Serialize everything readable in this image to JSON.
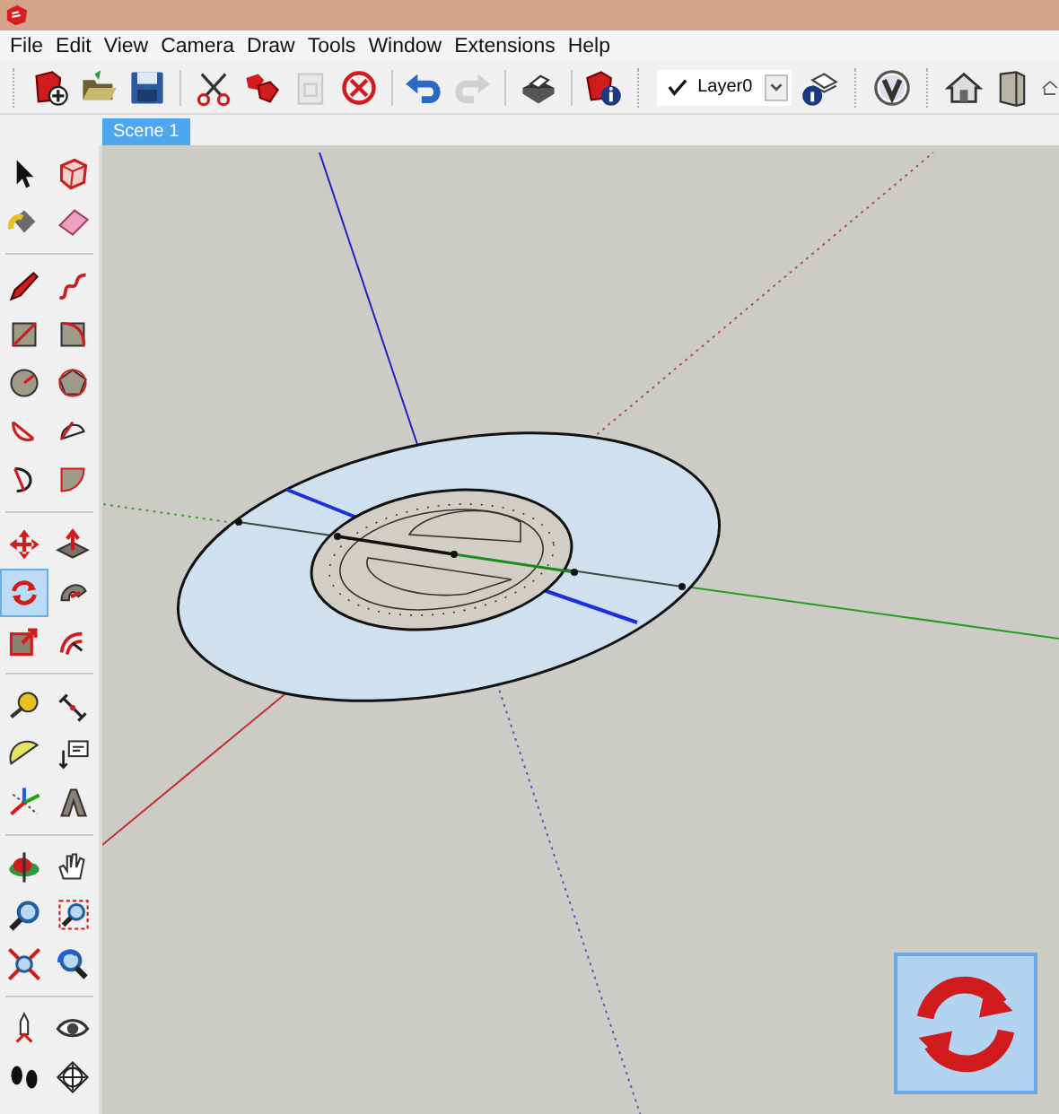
{
  "menu": [
    "File",
    "Edit",
    "View",
    "Camera",
    "Draw",
    "Tools",
    "Window",
    "Extensions",
    "Help"
  ],
  "toolbar": [
    {
      "disabled": false
    },
    {
      "disabled": false
    },
    {
      "disabled": false
    },
    {
      "disabled": false
    },
    {
      "disabled": false
    },
    {
      "disabled": true
    },
    {
      "disabled": false
    },
    {
      "disabled": false
    },
    {
      "disabled": true
    },
    {
      "disabled": false
    },
    {
      "disabled": false
    }
  ],
  "layer_select": {
    "value": "Layer0"
  },
  "scene_tabs": [
    {
      "label": "Scene 1",
      "selected": true
    }
  ],
  "tool_groups": [
    {
      "tools": [
        {
          "selected": false
        },
        {
          "selected": false
        },
        {
          "selected": false
        },
        {
          "selected": false
        }
      ]
    },
    {
      "tools": [
        {
          "selected": false
        },
        {
          "selected": false
        },
        {
          "selected": false
        },
        {
          "selected": false
        },
        {
          "selected": false
        },
        {
          "selected": false
        },
        {
          "selected": false
        },
        {
          "selected": false
        },
        {
          "selected": false
        },
        {
          "selected": false
        }
      ]
    },
    {
      "tools": [
        {
          "selected": false
        },
        {
          "selected": false
        },
        {
          "selected": true
        },
        {
          "selected": false
        },
        {
          "selected": false
        },
        {
          "selected": false
        }
      ]
    },
    {
      "tools": [
        {
          "selected": false
        },
        {
          "selected": false
        },
        {
          "selected": false
        },
        {
          "selected": false
        },
        {
          "selected": false
        },
        {
          "selected": false
        }
      ]
    },
    {
      "tools": [
        {
          "selected": false
        },
        {
          "selected": false
        },
        {
          "selected": false
        },
        {
          "selected": false
        },
        {
          "selected": false
        },
        {
          "selected": false
        }
      ]
    },
    {
      "tools": [
        {
          "selected": false
        },
        {
          "selected": false
        },
        {
          "selected": false
        },
        {
          "selected": false
        }
      ]
    }
  ]
}
